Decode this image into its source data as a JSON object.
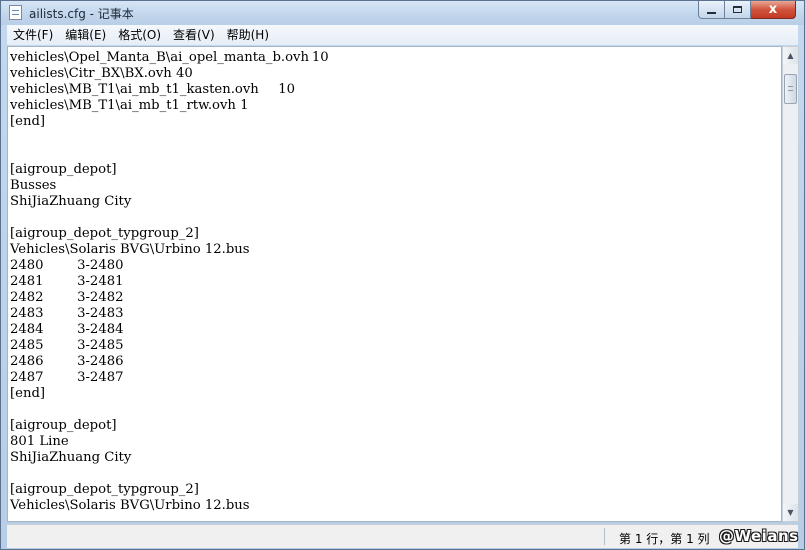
{
  "window": {
    "title": "ailists.cfg - 记事本",
    "buttons": {
      "minimize": "",
      "maximize": "",
      "close": "x"
    }
  },
  "menu": [
    "文件(F)",
    "编辑(E)",
    "格式(O)",
    "查看(V)",
    "帮助(H)"
  ],
  "document": {
    "text": "vehicles\\Opel_Manta_B\\ai_opel_manta_b.ovh\t10\nvehicles\\Citr_BX\\BX.ovh 40\nvehicles\\MB_T1\\ai_mb_t1_kasten.ovh\t10\nvehicles\\MB_T1\\ai_mb_t1_rtw.ovh 1\n[end]\n\n\n[aigroup_depot]\nBusses\nShiJiaZhuang City\n\n[aigroup_depot_typgroup_2]\nVehicles\\Solaris BVG\\Urbino 12.bus\n2480\t3-2480\n2481\t3-2481\n2482\t3-2482\n2483\t3-2483\n2484\t3-2484\n2485\t3-2485\n2486\t3-2486\n2487\t3-2487\n[end]\n\n[aigroup_depot]\n801 Line\nShiJiaZhuang City\n\n[aigroup_depot_typgroup_2]\nVehicles\\Solaris BVG\\Urbino 12.bus"
  },
  "status": {
    "position": "第 1 行，第 1 列"
  },
  "watermark": "@Weians",
  "colors": {
    "titlebar": "#c2d6ec",
    "close_button": "#c94a33",
    "editor_background": "#ffffff"
  },
  "icons": {
    "app": "notepad-icon",
    "scroll_up": "scroll-up-arrow-icon",
    "scroll_down": "scroll-down-arrow-icon"
  }
}
